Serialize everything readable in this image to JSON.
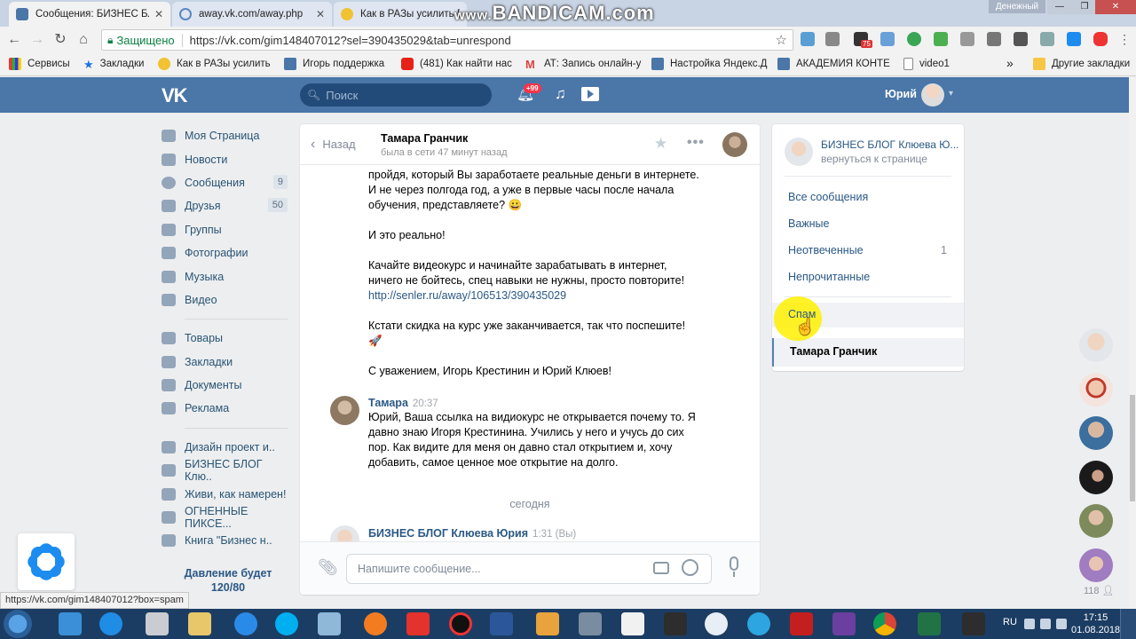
{
  "browser": {
    "tabs": [
      {
        "title": "Сообщения: БИЗНЕС БЛ",
        "active": true
      },
      {
        "title": "away.vk.com/away.php",
        "active": false
      },
      {
        "title": "Как в РАЗы усилить Вз",
        "active": false
      }
    ],
    "watermark_www": "www.",
    "watermark": "BANDICAM.com",
    "profile_name": "Денежный",
    "secure_label": "Защищено",
    "url": "https://vk.com/gim148407012?sel=390435029&tab=unrespond",
    "ext_badge": "75",
    "bookmarks": [
      "Сервисы",
      "Закладки",
      "Как в РАЗы усилить",
      "Игорь поддержка",
      "(481) Как найти нас",
      "АТ: Запись онлайн-у",
      "Настройка Яндекс.Д",
      "АКАДЕМИЯ КОНТЕ",
      "video1"
    ],
    "more_bookmarks": "»",
    "other_bookmarks": "Другие закладки",
    "status_url": "https://vk.com/gim148407012?box=spam"
  },
  "vk": {
    "logo": "VK",
    "search_placeholder": "Поиск",
    "notifications_badge": "+99",
    "user_name": "Юрий",
    "menu": [
      {
        "label": "Моя Страница",
        "count": ""
      },
      {
        "label": "Новости",
        "count": ""
      },
      {
        "label": "Сообщения",
        "count": "9"
      },
      {
        "label": "Друзья",
        "count": "50"
      },
      {
        "label": "Группы",
        "count": ""
      },
      {
        "label": "Фотографии",
        "count": ""
      },
      {
        "label": "Музыка",
        "count": ""
      },
      {
        "label": "Видео",
        "count": ""
      }
    ],
    "menu2": [
      "Товары",
      "Закладки",
      "Документы",
      "Реклама"
    ],
    "groups": [
      "Дизайн проект и..",
      "БИЗНЕС БЛОГ Клю..",
      "Живи, как намерен!",
      "ОГНЕННЫЕ ПИКСЕ...",
      "Книга \"Бизнес н.."
    ],
    "pressure_ad": "Давление будет 120/80"
  },
  "chat": {
    "back_label": "Назад",
    "partner_name": "Тамара Гранчик",
    "partner_status": "была в сети 47 минут назад",
    "messages": [
      "пройдя, который Вы заработаете реальные деньги в интернете. И не через полгода год, а уже в первые часы после начала обучения, представляете? 😀",
      "И это реально!",
      "Качайте видеокурс и начинайте зарабатывать в интернет, ничего не бойтесь, спец навыки не нужны, просто повторите!",
      "http://senler.ru/away/106513/390435029",
      "Кстати скидка на курс уже заканчивается, так что поспешите! 🚀",
      "С уважением, Игорь Крестинин и Юрий Клюев!"
    ],
    "reply_author": "Тамара",
    "reply_time": "20:37",
    "reply_text": "Юрий, Ваша ссылка на видиокурс не открывается почему то. Я давно знаю Игоря Крестинина. Учились у него и учусь до сих пор. Как видите для меня он давно стал открытием и, хочу добавить, самое ценное мое открытие на долго.",
    "day_divider": "сегодня",
    "last_author": "БИЗНЕС БЛОГ Клюева Юрия",
    "last_time": "1:31 (Вы)",
    "compose_placeholder": "Напишите сообщение..."
  },
  "filters": {
    "community_name": "БИЗНЕС БЛОГ Клюева Ю...",
    "return_label": "вернуться к странице",
    "items": [
      {
        "label": "Все сообщения",
        "count": ""
      },
      {
        "label": "Важные",
        "count": ""
      },
      {
        "label": "Неотвеченные",
        "count": "1"
      },
      {
        "label": "Непрочитанные",
        "count": ""
      }
    ],
    "spam_label": "Спам",
    "selected_dialog": "Тамара Гранчик"
  },
  "friends_online_count": "118",
  "taskbar": {
    "language": "RU",
    "time": "17:15",
    "date": "01.08.2018"
  },
  "colors": {
    "vk_header": "#4a76a8",
    "link": "#2a5885",
    "highlight": "#fff000",
    "taskbar": "#1c3d63"
  }
}
